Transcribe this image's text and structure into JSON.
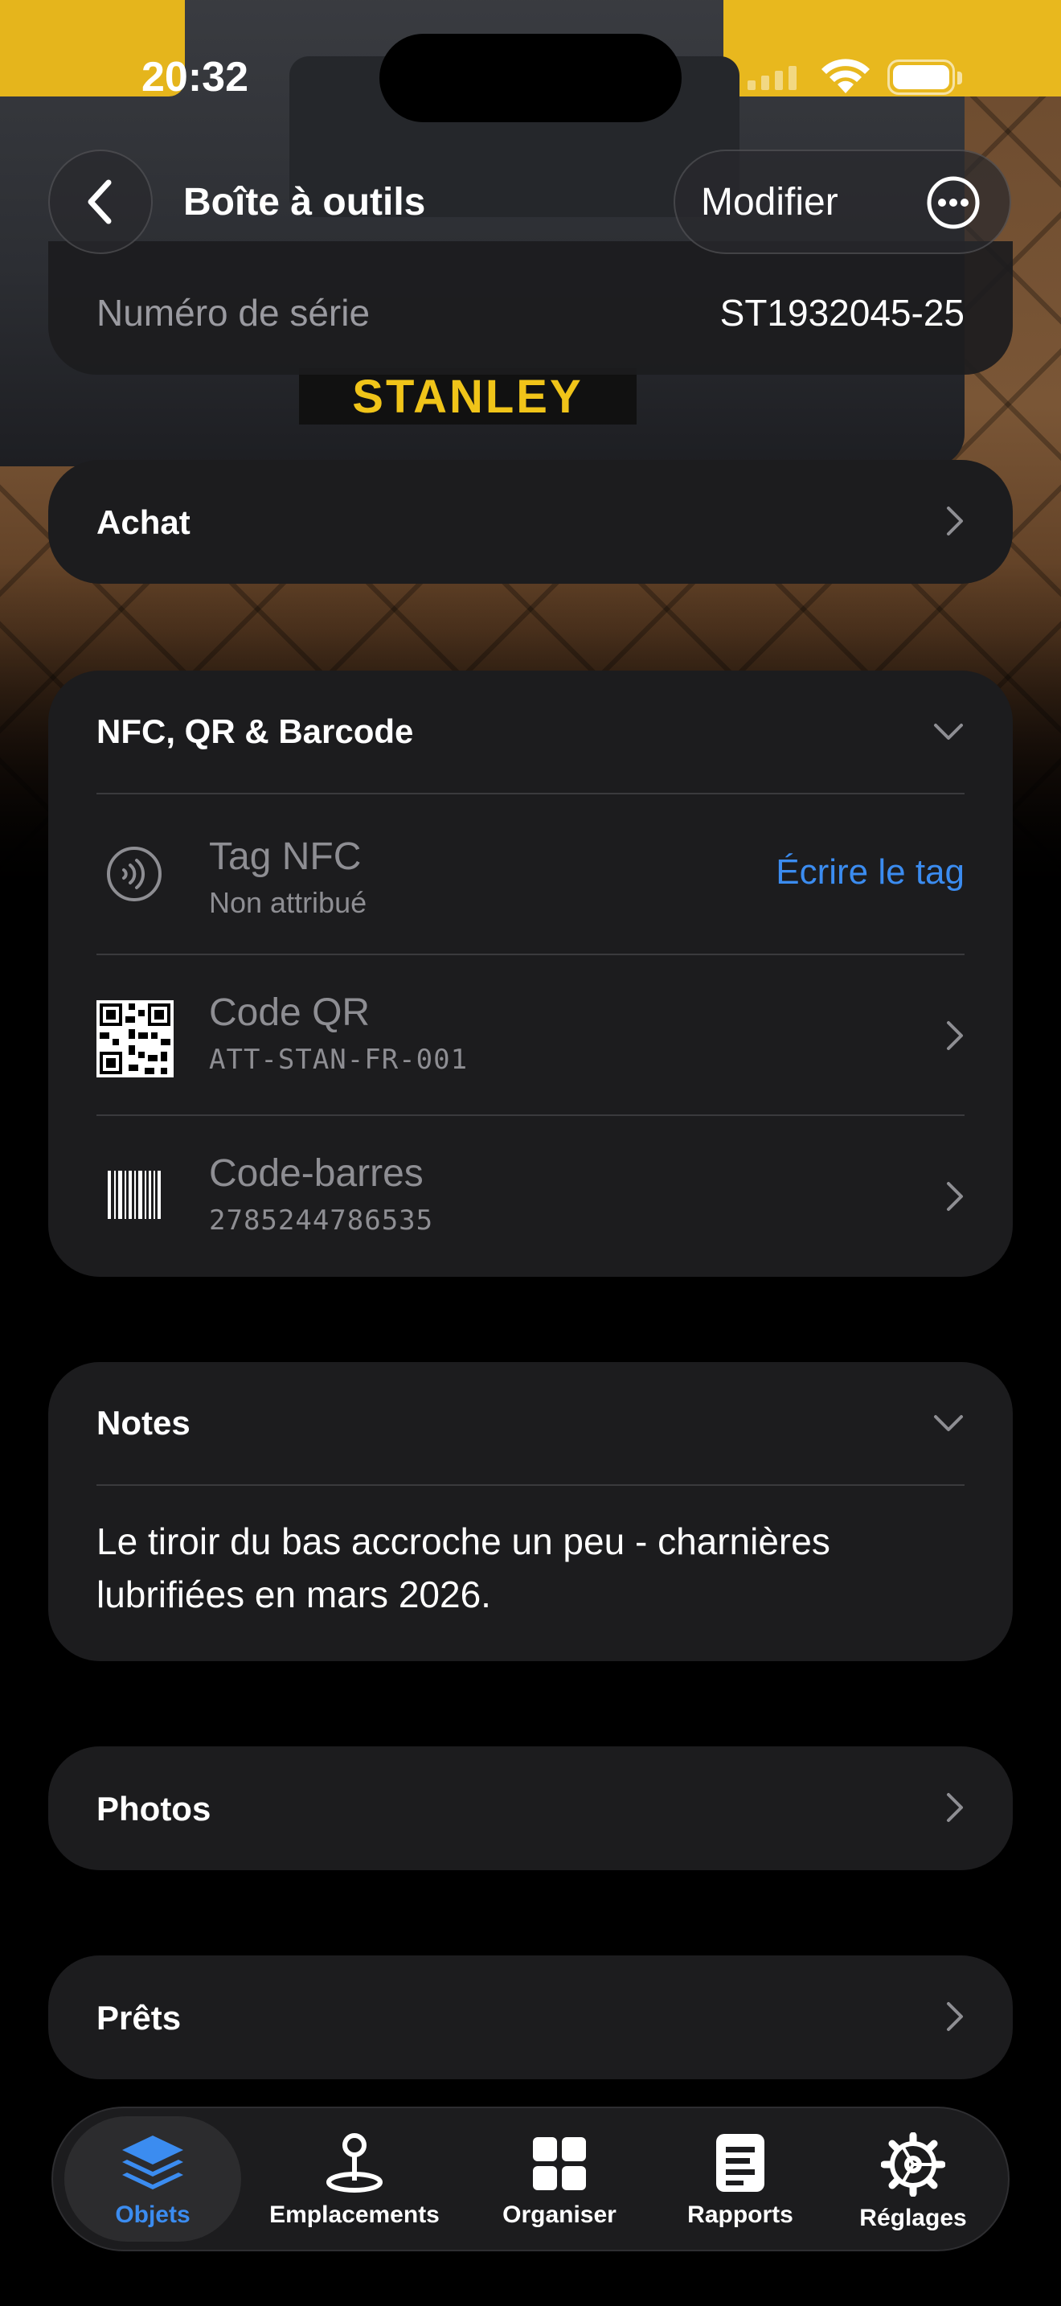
{
  "status_bar": {
    "time": "20:32"
  },
  "header": {
    "title": "Boîte à outils",
    "modify_label": "Modifier"
  },
  "background": {
    "brand_text": "STANLEY"
  },
  "serial": {
    "label": "Numéro de série",
    "value": "ST1932045-25"
  },
  "purchase": {
    "title": "Achat"
  },
  "nfc_section": {
    "title": "NFC, QR & Barcode",
    "nfc": {
      "title": "Tag NFC",
      "subtitle": "Non attribué",
      "action": "Écrire le tag"
    },
    "qr": {
      "title": "Code QR",
      "value": "ATT-STAN-FR-001"
    },
    "barcode": {
      "title": "Code-barres",
      "value": "2785244786535"
    }
  },
  "notes": {
    "title": "Notes",
    "text": "Le tiroir du bas accroche un peu - charnières lubrifiées en mars 2026."
  },
  "photos": {
    "title": "Photos"
  },
  "loans": {
    "title": "Prêts"
  },
  "tabs": [
    {
      "label": "Objets",
      "icon": "stack-icon",
      "active": true
    },
    {
      "label": "Emplacements",
      "icon": "location-pin-icon",
      "active": false
    },
    {
      "label": "Organiser",
      "icon": "grid-icon",
      "active": false
    },
    {
      "label": "Rapports",
      "icon": "report-icon",
      "active": false
    },
    {
      "label": "Réglages",
      "icon": "gear-icon",
      "active": false
    }
  ],
  "colors": {
    "accent": "#3b8cf0",
    "card": "#1c1c1e",
    "background": "#000000"
  }
}
